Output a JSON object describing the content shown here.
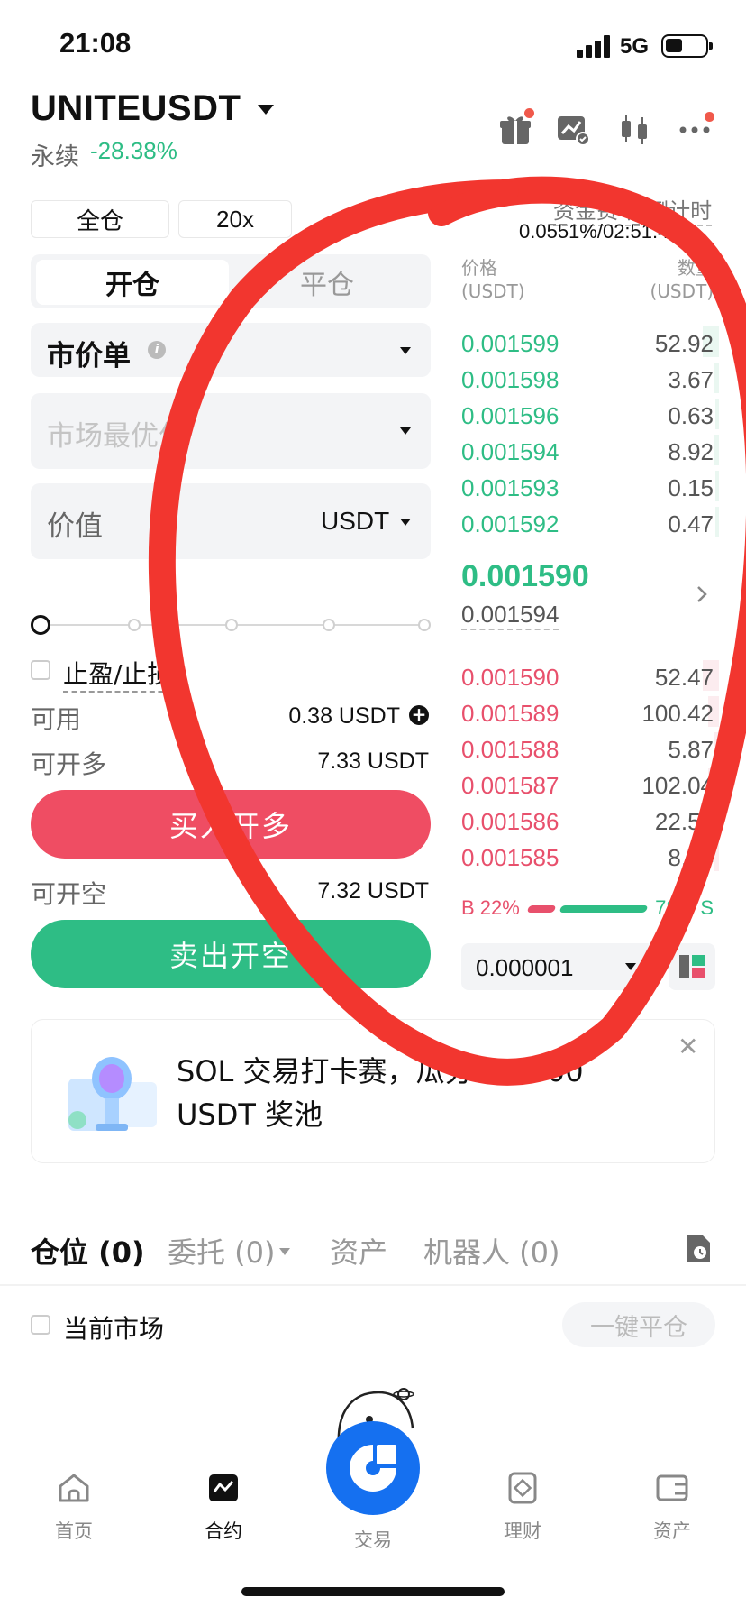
{
  "status_bar": {
    "time": "21:08",
    "network": "5G"
  },
  "header": {
    "symbol": "UNITEUSDT",
    "contract_type": "永续",
    "change": "-28.38%",
    "icons": [
      "gift-icon",
      "chart-compare-icon",
      "candlestick-icon",
      "more-icon"
    ]
  },
  "settings": {
    "margin_mode": "全仓",
    "leverage": "20x",
    "funding_label": "资金费率/倒计时",
    "funding_value": "0.0551%/02:51:47"
  },
  "order_tabs": {
    "open": "开仓",
    "close": "平仓"
  },
  "order_form": {
    "order_type": "市价单",
    "price_placeholder": "市场最优价",
    "amount_label": "价值",
    "amount_unit": "USDT",
    "slider_percent": 0,
    "tpsl_label": "止盈/止损",
    "available_label": "可用",
    "available_value": "0.38 USDT",
    "can_open_long_label": "可开多",
    "can_open_long_value": "7.33 USDT",
    "buy_button": "买入开多",
    "can_open_short_label": "可开空",
    "can_open_short_value": "7.32 USDT",
    "sell_button": "卖出开空"
  },
  "orderbook": {
    "price_header": "价格",
    "price_unit": "(USDT)",
    "qty_header": "数量",
    "qty_unit": "(USDT)",
    "asks": [
      {
        "price": "0.001599",
        "qty": "52.92"
      },
      {
        "price": "0.001598",
        "qty": "3.67"
      },
      {
        "price": "0.001596",
        "qty": "0.63"
      },
      {
        "price": "0.001594",
        "qty": "8.92"
      },
      {
        "price": "0.001593",
        "qty": "0.15"
      },
      {
        "price": "0.001592",
        "qty": "0.47"
      }
    ],
    "last_price": "0.001590",
    "mark_price": "0.001594",
    "bids": [
      {
        "price": "0.001590",
        "qty": "52.47"
      },
      {
        "price": "0.001589",
        "qty": "100.42"
      },
      {
        "price": "0.001588",
        "qty": "5.87"
      },
      {
        "price": "0.001587",
        "qty": "102.04"
      },
      {
        "price": "0.001586",
        "qty": "22.52"
      },
      {
        "price": "0.001585",
        "qty": "8.24"
      }
    ],
    "buy_ratio": "B 22%",
    "sell_ratio": "78% S",
    "tick_size": "0.000001"
  },
  "banner": {
    "text": "SOL 交易打卡赛，瓜分 30,000 USDT 奖池"
  },
  "position_tabs": [
    "仓位 (0)",
    "委托 (0)",
    "资产",
    "机器人 (0)"
  ],
  "position_filter": {
    "current_market": "当前市场",
    "close_all": "一键平仓"
  },
  "bottom_nav": [
    {
      "label": "首页",
      "icon": "home-icon"
    },
    {
      "label": "合约",
      "icon": "futures-icon"
    },
    {
      "label": "交易",
      "icon": "trade-icon"
    },
    {
      "label": "理财",
      "icon": "earn-icon"
    },
    {
      "label": "资产",
      "icon": "wallet-icon"
    }
  ],
  "colors": {
    "up": "#2ebd85",
    "down": "#e8506c",
    "annotation": "#f2362f",
    "brand": "#1570f0"
  }
}
